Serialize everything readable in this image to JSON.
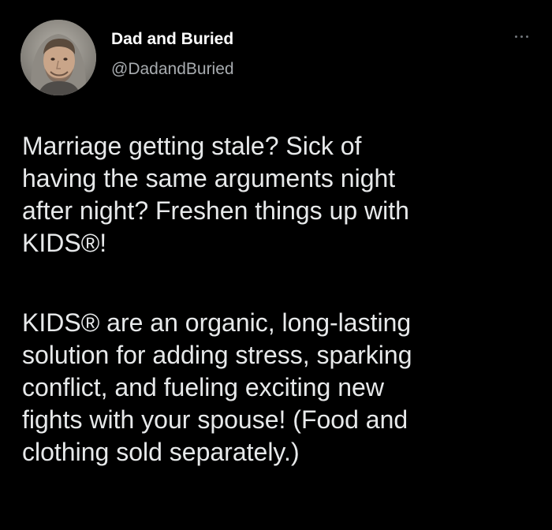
{
  "tweet": {
    "display_name": "Dad and Buried",
    "handle": "@DadandBuried",
    "more_icon": "more-horizontal-icon",
    "paragraphs": [
      {
        "lines": [
          "Marriage getting stale? Sick of",
          "having the same arguments night",
          "after night? Freshen things up with",
          "KIDS®!"
        ]
      },
      {
        "lines": [
          "KIDS® are an organic, long-lasting",
          "solution for adding stress, sparking",
          "conflict, and fueling exciting new",
          "fights with your spouse! (Food and",
          "clothing sold separately.)"
        ]
      }
    ]
  },
  "colors": {
    "background": "#000000",
    "text": "#e7e9ea",
    "name": "#ffffff",
    "secondary": "#a8acb0"
  }
}
